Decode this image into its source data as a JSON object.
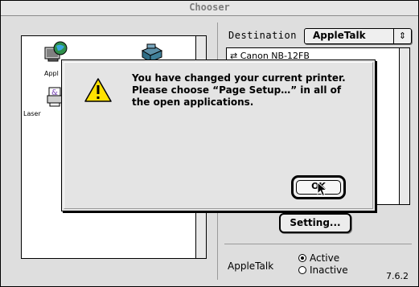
{
  "window": {
    "title": "Chooser"
  },
  "left_panel": {
    "drivers": [
      {
        "label": "Appl",
        "icon": "appleshare-globe-icon"
      },
      {
        "label": "",
        "icon": "printer-book-icon"
      },
      {
        "label": "Laser",
        "icon": "laserwriter-icon"
      }
    ]
  },
  "destination": {
    "label": "Destination",
    "value": "AppleTalk",
    "arrows": "⇕"
  },
  "printers": [
    "⇄ Canon NB-12FB"
  ],
  "setup_button": "Setting...",
  "appletalk": {
    "label": "AppleTalk",
    "active": "Active",
    "inactive": "Inactive",
    "selected": "Active"
  },
  "version": "7.6.2",
  "alert": {
    "message": "You have changed your current printer. Please choose “Page Setup…” in all of the open applications.",
    "ok_label": "OK",
    "icon": "caution-icon"
  },
  "colors": {
    "window_bg": "#dedede",
    "dialog_bg": "#e4e4e4",
    "caution_yellow": "#ffe100"
  }
}
